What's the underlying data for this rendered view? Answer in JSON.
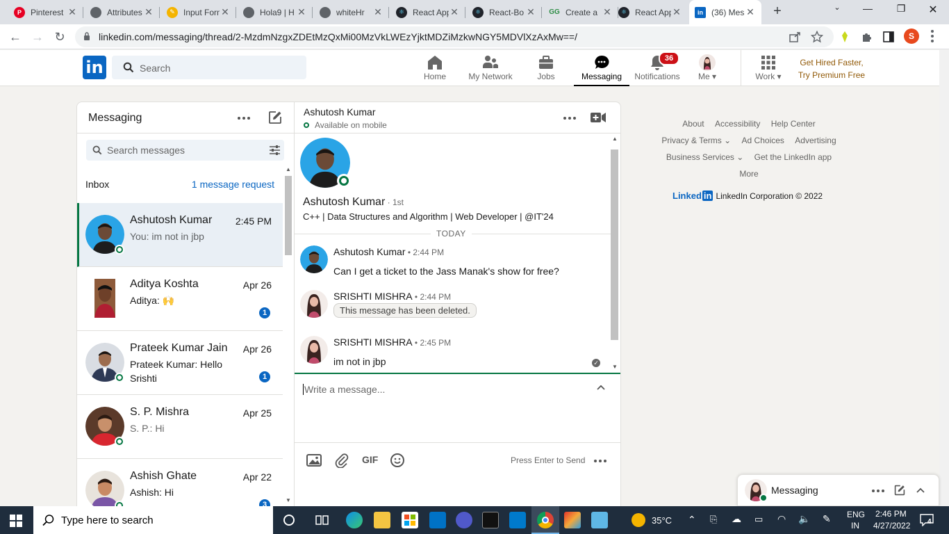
{
  "browser": {
    "tabs": [
      {
        "title": "Pinterest",
        "color": "#e60023",
        "glyph": "P"
      },
      {
        "title": "Attributes",
        "color": "#5f6368",
        "glyph": "◉"
      },
      {
        "title": "Input Form",
        "color": "#f4b400",
        "glyph": "✎"
      },
      {
        "title": "Hola9 | H",
        "color": "#5f6368",
        "glyph": "◉"
      },
      {
        "title": "whiteHr",
        "color": "#5f6368",
        "glyph": "◉"
      },
      {
        "title": "React App",
        "color": "#20232a",
        "glyph": "⚛"
      },
      {
        "title": "React-Bo",
        "color": "#20232a",
        "glyph": "⚛"
      },
      {
        "title": "Create a",
        "color": "#2f8d46",
        "glyph": "GG"
      },
      {
        "title": "React App",
        "color": "#20232a",
        "glyph": "⚛"
      },
      {
        "title": "(36) Mes",
        "color": "#0a66c2",
        "glyph": "in"
      }
    ],
    "url": "linkedin.com/messaging/thread/2-MzdmNzgxZDEtMzQxMi00MzVkLWEzYjktMDZiMzkwNGY5MDVlXzAxMw==/",
    "profile_initial": "S"
  },
  "linkedin_nav": {
    "logo": "in",
    "search_placeholder": "Search",
    "items": [
      {
        "label": "Home"
      },
      {
        "label": "My Network"
      },
      {
        "label": "Jobs"
      },
      {
        "label": "Messaging"
      },
      {
        "label": "Notifications",
        "badge": "36"
      },
      {
        "label": "Me"
      },
      {
        "label": "Work"
      }
    ],
    "premium_line1": "Get Hired Faster,",
    "premium_line2": "Try Premium Free"
  },
  "messaging": {
    "title": "Messaging",
    "search_placeholder": "Search messages",
    "inbox_label": "Inbox",
    "request_link": "1 message request",
    "conversations": [
      {
        "name": "Ashutosh Kumar",
        "time": "2:45 PM",
        "snippet": "You: im not in jbp",
        "unread": "",
        "online": true
      },
      {
        "name": "Aditya Koshta",
        "time": "Apr 26",
        "snippet": "Aditya: 🙌",
        "unread": "1",
        "online": false
      },
      {
        "name": "Prateek Kumar Jain",
        "time": "Apr 26",
        "snippet": "Prateek Kumar: Hello Srishti",
        "unread": "1",
        "online": true
      },
      {
        "name": "S. P. Mishra",
        "time": "Apr 25",
        "snippet": "S. P.: Hi",
        "unread": "",
        "online": true
      },
      {
        "name": "Ashish Ghate",
        "time": "Apr 22",
        "snippet": "Ashish: Hi",
        "unread": "3",
        "online": true
      }
    ]
  },
  "thread": {
    "name": "Ashutosh Kumar",
    "status": "Available on mobile",
    "profile_name": "Ashutosh Kumar",
    "degree": " · 1st",
    "headline": "C++ | Data Structures and Algorithm | Web Developer | @IT'24",
    "divider": "TODAY",
    "messages": [
      {
        "sender": "Ashutosh Kumar",
        "time": " • 2:44 PM",
        "text": "Can I get a ticket to the Jass Manak's show for free?"
      },
      {
        "sender": "SRISHTI MISHRA",
        "time": " • 2:44 PM",
        "text": "This message has been deleted."
      },
      {
        "sender": "SRISHTI MISHRA",
        "time": " • 2:45 PM",
        "text": "im not in jbp"
      }
    ],
    "compose_placeholder": "Write a message...",
    "gif_label": "GIF",
    "send_hint": "Press Enter to Send"
  },
  "right_rail": {
    "links_row1": [
      "About",
      "Accessibility",
      "Help Center"
    ],
    "links_row2": [
      "Privacy & Terms ⌄",
      "Ad Choices",
      "Advertising"
    ],
    "links_row3": [
      "Business Services ⌄",
      "Get the LinkedIn app"
    ],
    "links_row4": [
      "More"
    ],
    "corp_brand": "Linked",
    "corp_brand_in": "in",
    "corp_text": "LinkedIn Corporation © 2022"
  },
  "floating": {
    "label": "Messaging"
  },
  "taskbar": {
    "search_placeholder": "Type here to search",
    "temperature": "35°C",
    "lang1": "ENG",
    "lang2": "IN",
    "time": "2:46 PM",
    "date": "4/27/2022",
    "notif_count": "4"
  },
  "colors": {
    "linkedin_blue": "#0a66c2",
    "online_green": "#057642",
    "badge_red": "#cc1016",
    "premium_gold": "#915907"
  }
}
